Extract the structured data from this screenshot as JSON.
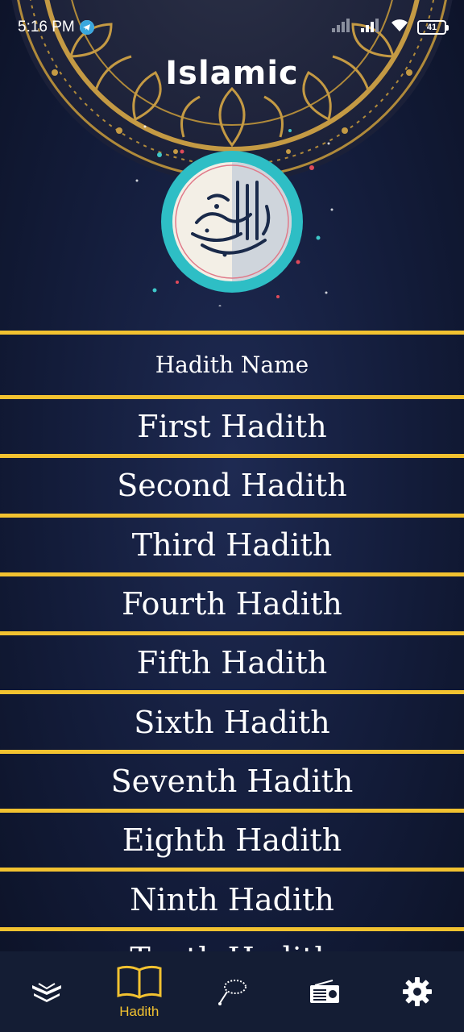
{
  "status_bar": {
    "time": "5:16 PM",
    "battery": "41"
  },
  "header": {
    "title": "Islamic"
  },
  "table": {
    "header": "Hadith Name",
    "rows": [
      "First Hadith",
      "Second Hadith",
      "Third Hadith",
      "Fourth Hadith",
      "Fifth Hadith",
      "Sixth Hadith",
      "Seventh Hadith",
      "Eighth Hadith",
      "Ninth Hadith",
      "Tenth Hadith"
    ]
  },
  "bottom_nav": {
    "items": [
      {
        "icon": "quran-icon",
        "label": ""
      },
      {
        "icon": "book-icon",
        "label": "Hadith",
        "active": true
      },
      {
        "icon": "tasbeeh-icon",
        "label": ""
      },
      {
        "icon": "radio-icon",
        "label": ""
      },
      {
        "icon": "gear-icon",
        "label": ""
      }
    ]
  },
  "colors": {
    "accent": "#f2c230",
    "background": "#131c3a",
    "nav_background": "#141d34"
  }
}
